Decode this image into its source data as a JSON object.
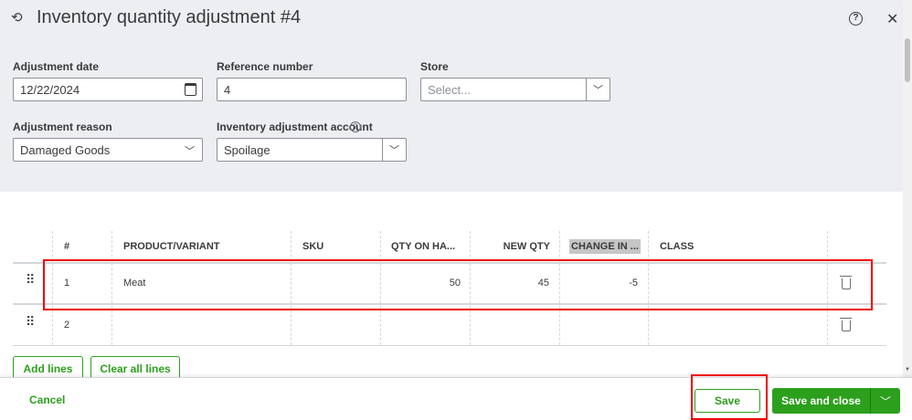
{
  "header": {
    "title": "Inventory quantity adjustment #4",
    "help": "?",
    "close": "✕"
  },
  "form": {
    "date_label": "Adjustment date",
    "date_value": "12/22/2024",
    "ref_label": "Reference number",
    "ref_value": "4",
    "store_label": "Store",
    "store_placeholder": "Select...",
    "reason_label": "Adjustment reason",
    "reason_value": "Damaged Goods",
    "account_label": "Inventory adjustment account",
    "account_value": "Spoilage"
  },
  "table": {
    "columns": [
      "#",
      "PRODUCT/VARIANT",
      "SKU",
      "QTY ON HA...",
      "NEW QTY",
      "CHANGE IN ...",
      "CLASS"
    ],
    "rows": [
      {
        "num": "1",
        "product": "Meat",
        "sku": "",
        "qty_on_hand": "50",
        "new_qty": "45",
        "change": "-5",
        "class": ""
      },
      {
        "num": "2",
        "product": "",
        "sku": "",
        "qty_on_hand": "",
        "new_qty": "",
        "change": "",
        "class": ""
      }
    ]
  },
  "actions": {
    "add_lines": "Add lines",
    "clear_lines": "Clear all lines"
  },
  "footer": {
    "cancel": "Cancel",
    "save": "Save",
    "save_close": "Save and close"
  },
  "colors": {
    "accent": "#2ca01c",
    "highlight": "#e00000"
  }
}
